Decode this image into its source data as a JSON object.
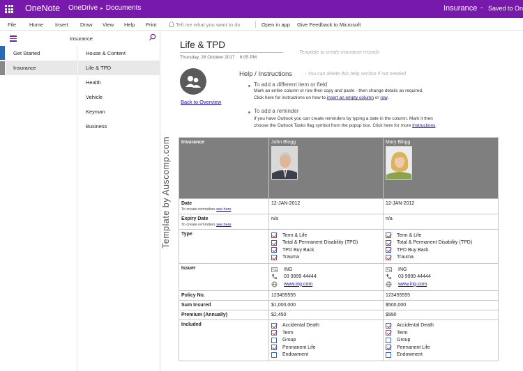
{
  "titlebar": {
    "app_name": "OneNote",
    "breadcrumb_onedrive": "OneDrive",
    "breadcrumb_sep": "▸",
    "breadcrumb_documents": "Documents",
    "notebook": "Insurance",
    "dash": "-",
    "status": "Saved to One"
  },
  "ribbon": {
    "file": "File",
    "home": "Home",
    "insert": "Insert",
    "draw": "Draw",
    "view": "View",
    "help": "Help",
    "print": "Print",
    "tell_me": "Tell me what you want to do",
    "open_in_app": "Open in app",
    "feedback": "Give Feedback to Microsoft"
  },
  "nav": {
    "notebook_title": "Insurance",
    "sections": [
      {
        "label": "Get Started",
        "selected": false
      },
      {
        "label": "Insurance",
        "selected": true
      }
    ],
    "pages": [
      {
        "label": "House & Content",
        "selected": false
      },
      {
        "label": "Life & TPD",
        "selected": true
      },
      {
        "label": "Health",
        "selected": false
      },
      {
        "label": "Vehicle",
        "selected": false
      },
      {
        "label": "Keyman",
        "selected": false
      },
      {
        "label": "Business",
        "selected": false
      }
    ],
    "accent": "#7719aa",
    "edge_tab_colors": [
      "#2b6cb0",
      "#888888"
    ]
  },
  "page": {
    "watermark": "Template by Auscomp.com",
    "title": "Life & TPD",
    "date": "Thursday, 26 October 2017",
    "time": "6:05 PM",
    "template_note": "Template to create insurance records",
    "back_link": "Back to Overview",
    "help": {
      "title": "Help / Instructions",
      "note": "- You can delete this help section if not needed",
      "item1_head": "To add a different item or field",
      "item1_line1": "Mark an entire column or row then copy and paste - then change details as required.",
      "item1_line2_pre": "Click here for instructions on how to ",
      "item1_link1": "insert an empty column",
      "item1_mid": " or ",
      "item1_link2": "row",
      "item1_end": ".",
      "item2_head": "To add a reminder",
      "item2_line1": "If you have Outlook you can create reminders by typing a date in the column. Mark it then",
      "item2_line2_pre": "choose the Outlook Tasks flag symbol from the popup box. Click here for more ",
      "item2_link": "Instructions",
      "item2_end": "."
    }
  },
  "table": {
    "header_label": "Insurance",
    "persons": [
      {
        "name": "John Blogg",
        "photo": "man-photo"
      },
      {
        "name": "Mary Blogg",
        "photo": "woman-photo"
      }
    ],
    "date_label": "Date",
    "date_sub": "To create reminders ",
    "date_sub_link": "see here",
    "date_values": [
      "12-JAN-2012",
      "12-JAN-2012"
    ],
    "expiry_label": "Expiry Date",
    "expiry_sub": "To create reminders ",
    "expiry_sub_link": "see here",
    "expiry_values": [
      "n/a",
      "n/a"
    ],
    "type_label": "Type",
    "type_items": [
      [
        {
          "label": "Term & Life",
          "checked": true
        },
        {
          "label": "Total & Permanent Disability (TPD)",
          "checked": true
        },
        {
          "label": "TPD Buy Back",
          "checked": true
        },
        {
          "label": "Trauma",
          "checked": true
        }
      ],
      [
        {
          "label": "Term & Life",
          "checked": true
        },
        {
          "label": "Total & Permanent Disability (TPD)",
          "checked": true
        },
        {
          "label": "TPD Buy Back",
          "checked": true
        },
        {
          "label": "Trauma",
          "checked": true
        }
      ]
    ],
    "issuer_label": "Issuer",
    "issuer": [
      {
        "name": "ING",
        "phone": "03 9999 44444",
        "web": "www.ing.com"
      },
      {
        "name": "ING",
        "phone": "03 9999 44444",
        "web": "www.ing.com"
      }
    ],
    "policy_label": "Policy No.",
    "policy_values": [
      "123455555",
      "123455555"
    ],
    "sum_label": "Sum Insured",
    "sum_values": [
      "$1,000,000",
      "$500,000"
    ],
    "premium_label": "Premium (Annually)",
    "premium_values": [
      "$2,450",
      "$990"
    ],
    "included_label": "Included",
    "included_items": [
      [
        {
          "label": "Accidental Death",
          "checked": true
        },
        {
          "label": "Term",
          "checked": true
        },
        {
          "label": "Group",
          "checked": false
        },
        {
          "label": "Permanent Life",
          "checked": true
        },
        {
          "label": "Endowment",
          "checked": false
        }
      ],
      [
        {
          "label": "Accidental Death",
          "checked": true
        },
        {
          "label": "Term",
          "checked": true
        },
        {
          "label": "Group",
          "checked": false
        },
        {
          "label": "Permanent Life",
          "checked": true
        },
        {
          "label": "Endowment",
          "checked": false
        }
      ]
    ]
  }
}
